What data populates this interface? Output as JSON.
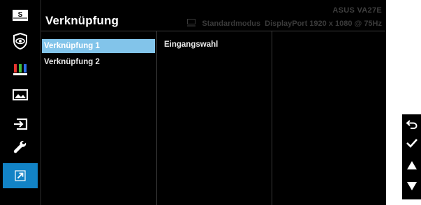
{
  "header": {
    "title": "Verknüpfung",
    "model": "ASUS  VA27E",
    "mode": "Standardmodus",
    "input_info": "DisplayPort 1920 x 1080 @ 75Hz"
  },
  "sidebar": {
    "icons": [
      {
        "name": "splendid",
        "glyph": "S"
      },
      {
        "name": "blue-light-filter"
      },
      {
        "name": "color"
      },
      {
        "name": "image"
      },
      {
        "name": "input-select"
      },
      {
        "name": "system-setup"
      },
      {
        "name": "shortcut",
        "active": true
      }
    ]
  },
  "menu": {
    "items": [
      {
        "label": "Verknüpfung 1",
        "selected": true
      },
      {
        "label": "Verknüpfung 2",
        "selected": false
      }
    ],
    "submenu": {
      "label": "Eingangswahl"
    }
  },
  "controls": [
    "back",
    "confirm",
    "up",
    "down"
  ],
  "colors": {
    "background": "#000000",
    "accent": "#1283c6",
    "selection": "#82c4ea",
    "dim_text": "#3a3a3a"
  }
}
